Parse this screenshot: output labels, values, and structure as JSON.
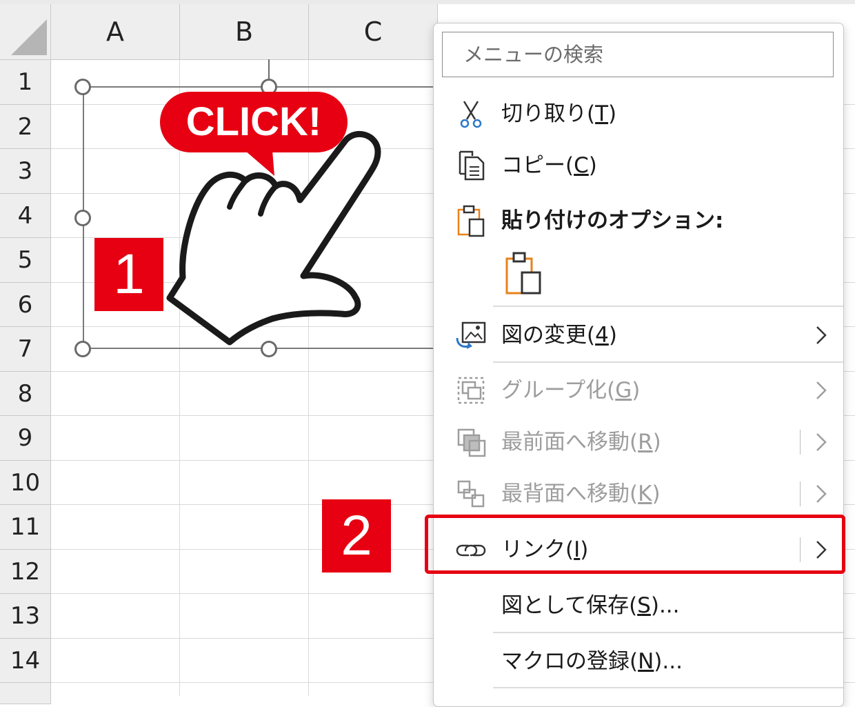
{
  "sheet": {
    "columns": [
      "A",
      "B",
      "C"
    ],
    "rows": [
      "1",
      "2",
      "3",
      "4",
      "5",
      "6",
      "7",
      "8",
      "9",
      "10",
      "11",
      "12",
      "13",
      "14"
    ]
  },
  "picture": {
    "speech_text": "CLICK!"
  },
  "badges": {
    "step1": "1",
    "step2": "2"
  },
  "colors": {
    "badge_red": "#e60012",
    "clip_orange": "#e8821a",
    "icon_blue": "#2b78c5"
  },
  "menu": {
    "search_placeholder": "メニューの検索",
    "cut": {
      "label": "切り取り(",
      "key": "T",
      "end": ")"
    },
    "copy": {
      "label": "コピー(",
      "key": "C",
      "end": ")"
    },
    "paste_options": {
      "label": "貼り付けのオプション:"
    },
    "change_picture": {
      "label": "図の変更(",
      "key": "4",
      "end": ")"
    },
    "group": {
      "label": "グループ化(",
      "key": "G",
      "end": ")"
    },
    "bring_front": {
      "label": "最前面へ移動(",
      "key": "R",
      "end": ")"
    },
    "send_back": {
      "label": "最背面へ移動(",
      "key": "K",
      "end": ")"
    },
    "link": {
      "label": "リンク(",
      "key": "I",
      "end": ")"
    },
    "save_as_picture": {
      "label": "図として保存(",
      "key": "S",
      "end": ")..."
    },
    "assign_macro": {
      "label": "マクロの登録(",
      "key": "N",
      "end": ")..."
    }
  }
}
